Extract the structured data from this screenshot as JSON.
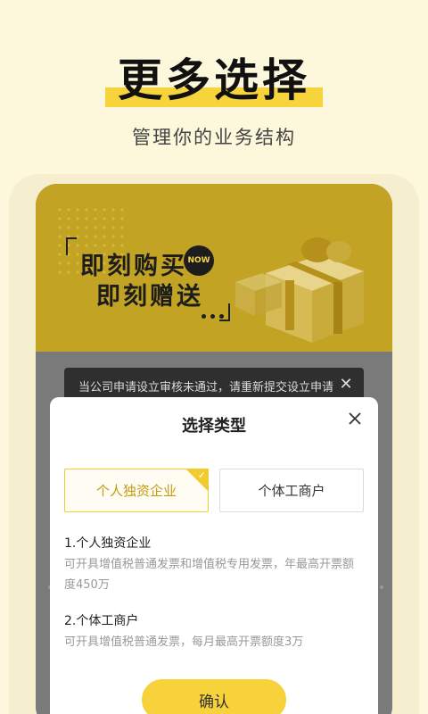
{
  "headline": "更多选择",
  "subtitle": "管理你的业务结构",
  "banner": {
    "line1": "即刻购买",
    "line2": "即刻赠送",
    "badge": "NOW"
  },
  "toast": {
    "message": "当公司申请设立审核未通过，请重新提交设立申请",
    "close_icon": "close-icon"
  },
  "dialog": {
    "title": "选择类型",
    "options": [
      {
        "label": "个人独资企业",
        "selected": true
      },
      {
        "label": "个体工商户",
        "selected": false
      }
    ],
    "descriptions": [
      {
        "title": "1.个人独资企业",
        "text": "可开具增值税普通发票和增值税专用发票，年最高开票额度450万"
      },
      {
        "title": "2.个体工商户",
        "text": "可开具增值税普通发票，每月最高开票额度3万"
      }
    ],
    "confirm_label": "确认"
  },
  "colors": {
    "accent": "#f8d23a",
    "background": "#fdf7dc",
    "banner": "#c2a323",
    "selected_text": "#c39a10"
  }
}
